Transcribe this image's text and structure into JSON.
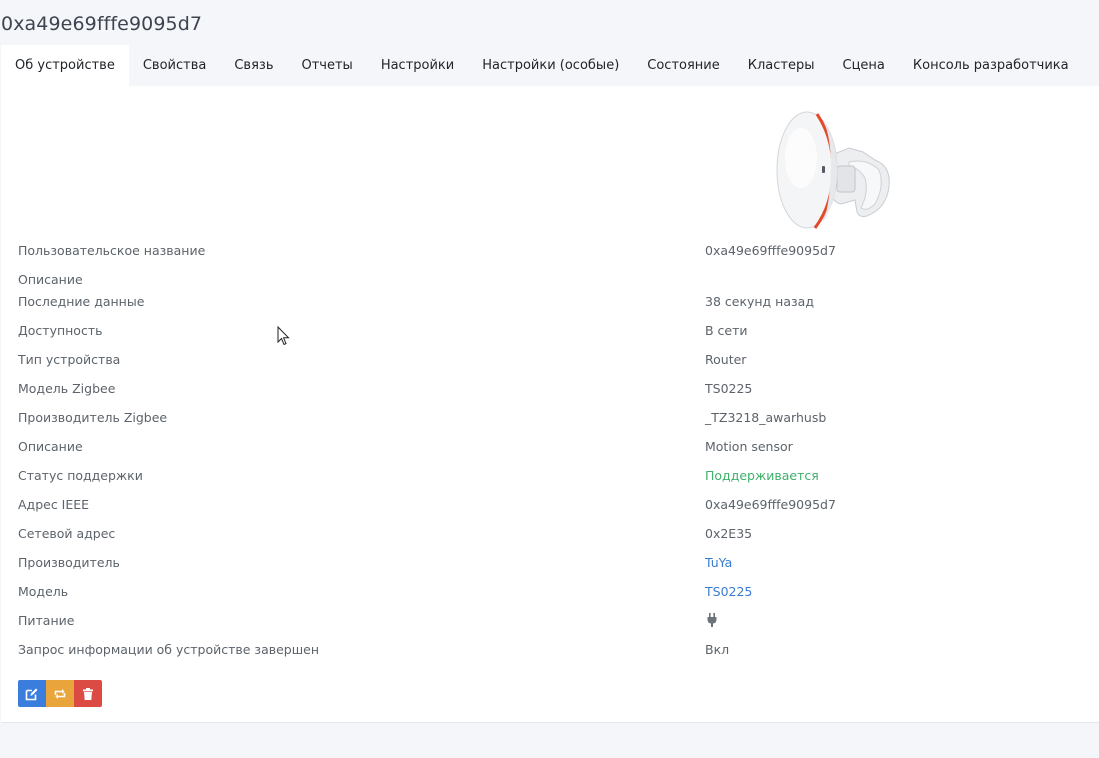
{
  "page_title": "0xa49e69fffe9095d7",
  "tabs": [
    {
      "label": "Об устройстве"
    },
    {
      "label": "Свойства"
    },
    {
      "label": "Связь"
    },
    {
      "label": "Отчеты"
    },
    {
      "label": "Настройки"
    },
    {
      "label": "Настройки (особые)"
    },
    {
      "label": "Состояние"
    },
    {
      "label": "Кластеры"
    },
    {
      "label": "Сцена"
    },
    {
      "label": "Консоль разработчика"
    }
  ],
  "info": {
    "friendly_name": {
      "label": "Пользовательское название",
      "value": "0xa49e69fffe9095d7"
    },
    "description_label": "Описание",
    "last_seen": {
      "label": "Последние данные",
      "value": "38 секунд назад"
    },
    "availability": {
      "label": "Доступность",
      "value": "В сети"
    },
    "device_type": {
      "label": "Тип устройства",
      "value": "Router"
    },
    "zigbee_model": {
      "label": "Модель Zigbee",
      "value": "TS0225"
    },
    "zigbee_manufacturer": {
      "label": "Производитель Zigbee",
      "value": "_TZ3218_awarhusb"
    },
    "description": {
      "label": "Описание",
      "value": "Motion sensor"
    },
    "support_status": {
      "label": "Статус поддержки",
      "value": "Поддерживается"
    },
    "ieee_address": {
      "label": "Адрес IEEE",
      "value": "0xa49e69fffe9095d7"
    },
    "network_address": {
      "label": "Сетевой адрес",
      "value": "0x2E35"
    },
    "manufacturer": {
      "label": "Производитель",
      "value": "TuYa"
    },
    "model": {
      "label": "Модель",
      "value": "TS0225"
    },
    "power": {
      "label": "Питание",
      "icon": "plug-icon"
    },
    "interview_completed": {
      "label": "Запрос информации об устройстве завершен",
      "value": "Вкл"
    }
  },
  "colors": {
    "supported": "#3fb06b",
    "link": "#3a7cd0",
    "edit_button": "#3b7ddd",
    "reconfigure_button": "#e9a53c",
    "remove_button": "#dc4a44"
  },
  "icons": {
    "edit": "edit-icon",
    "reconfigure": "refresh-icon",
    "remove": "trash-icon"
  }
}
